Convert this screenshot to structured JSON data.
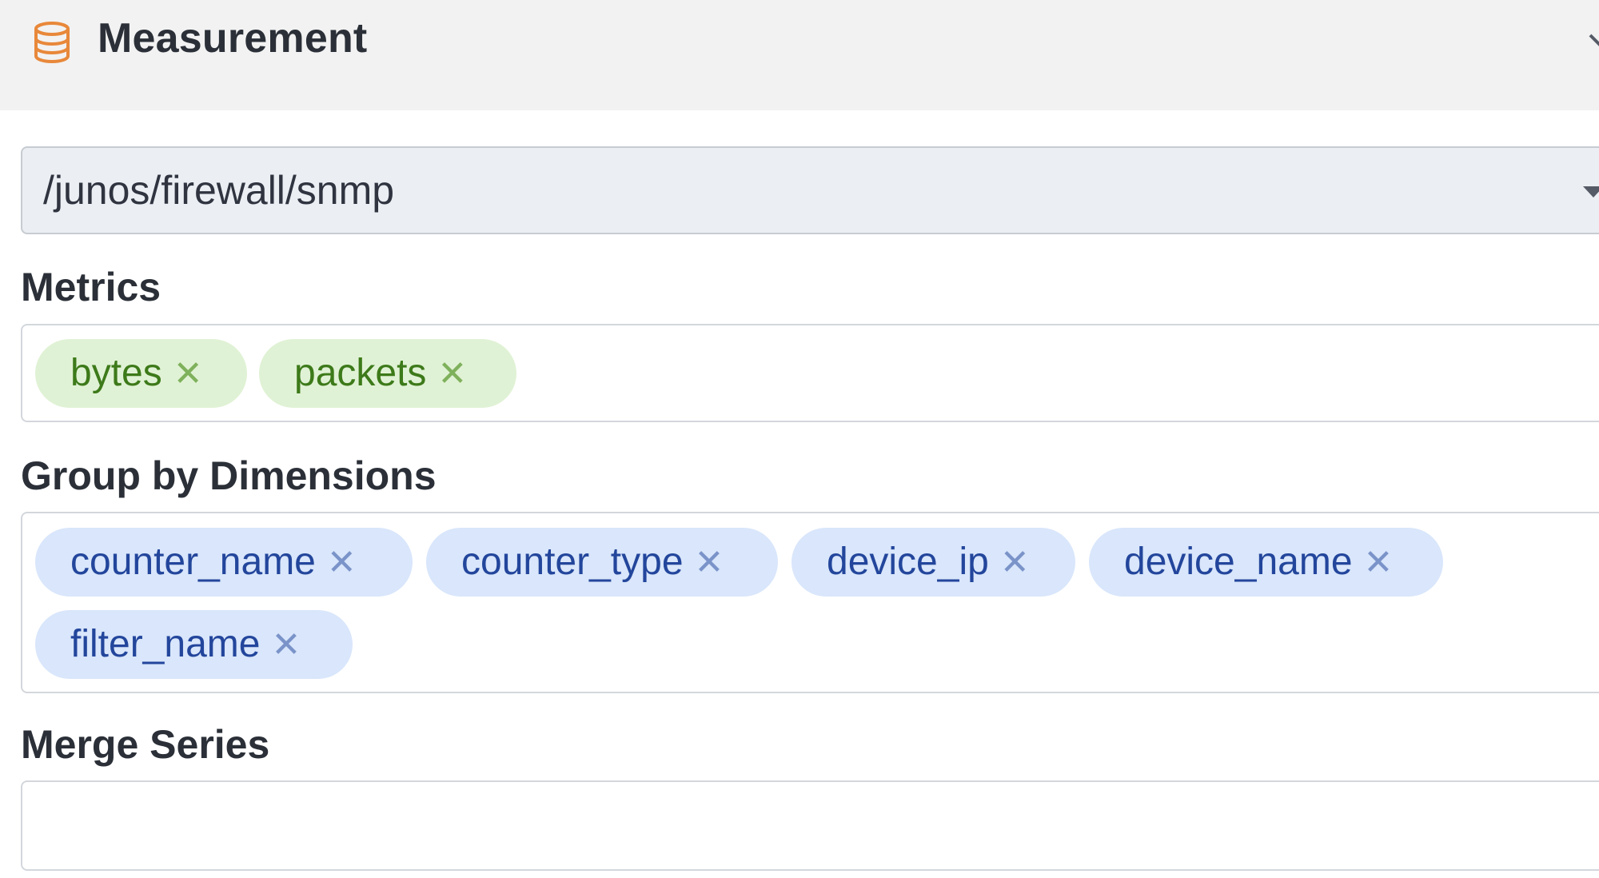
{
  "header": {
    "title": "Measurement",
    "icon": "database-icon",
    "chevron_icon": "chevron-down-icon"
  },
  "measurement_select": {
    "value": "/junos/firewall/snmp",
    "caret_icon": "caret-down-icon"
  },
  "metrics": {
    "label": "Metrics",
    "tags": [
      "bytes",
      "packets"
    ],
    "remove_glyph": "✕"
  },
  "group_by": {
    "label": "Group by Dimensions",
    "tags": [
      "counter_name",
      "counter_type",
      "device_ip",
      "device_name",
      "filter_name"
    ],
    "remove_glyph": "✕"
  },
  "merge_series": {
    "label": "Merge Series",
    "value": ""
  },
  "colors": {
    "header_bg": "#f2f2f2",
    "icon_accent": "#e8883a",
    "metric_tag_bg": "#e0f2d5",
    "metric_tag_text": "#3d7a1a",
    "dimension_tag_bg": "#d9e6fb",
    "dimension_tag_text": "#23469c"
  }
}
